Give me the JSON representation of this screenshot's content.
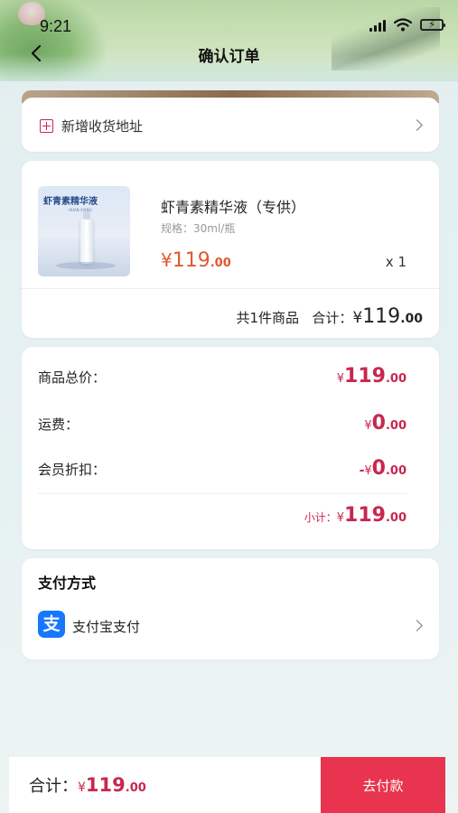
{
  "status_bar": {
    "time": "9:21"
  },
  "header": {
    "title": "确认订单"
  },
  "address": {
    "label": "新增收货地址"
  },
  "product": {
    "image_title": "虾青素精华液",
    "image_subtitle": "HUAN XIANG",
    "name": "虾青素精华液（专供）",
    "spec": "规格：30ml/瓶",
    "price": {
      "currency": "¥",
      "integer": "119",
      "decimal": ".00"
    },
    "quantity": "x 1",
    "count_text": "共1件商品",
    "total_label": "合计：",
    "total": {
      "currency": "¥",
      "integer": "119",
      "decimal": ".00"
    }
  },
  "summary": {
    "goods_total": {
      "label": "商品总价：",
      "currency": "¥",
      "integer": "119",
      "decimal": ".00"
    },
    "shipping": {
      "label": "运费：",
      "currency": "¥",
      "integer": "0",
      "decimal": ".00"
    },
    "member_discount": {
      "label": "会员折扣：",
      "sign": "-",
      "currency": "¥",
      "integer": "0",
      "decimal": ".00"
    },
    "subtotal": {
      "label": "小计：",
      "currency": "¥",
      "integer": "119",
      "decimal": ".00"
    }
  },
  "payment": {
    "title": "支付方式",
    "method_icon_glyph": "支",
    "method_label": "支付宝支付"
  },
  "bottom": {
    "total_label": "合计：",
    "currency": "¥",
    "integer": "119",
    "decimal": ".00",
    "pay_button": "去付款"
  },
  "colors": {
    "accent": "#c8274f",
    "price_orange": "#e0592d",
    "pay_button": "#e8344e",
    "alipay_blue": "#1677ff"
  },
  "icons": {
    "back": "chevron-left-icon",
    "add": "plus-square-icon",
    "chevron": "chevron-right-icon",
    "alipay": "alipay-icon"
  }
}
